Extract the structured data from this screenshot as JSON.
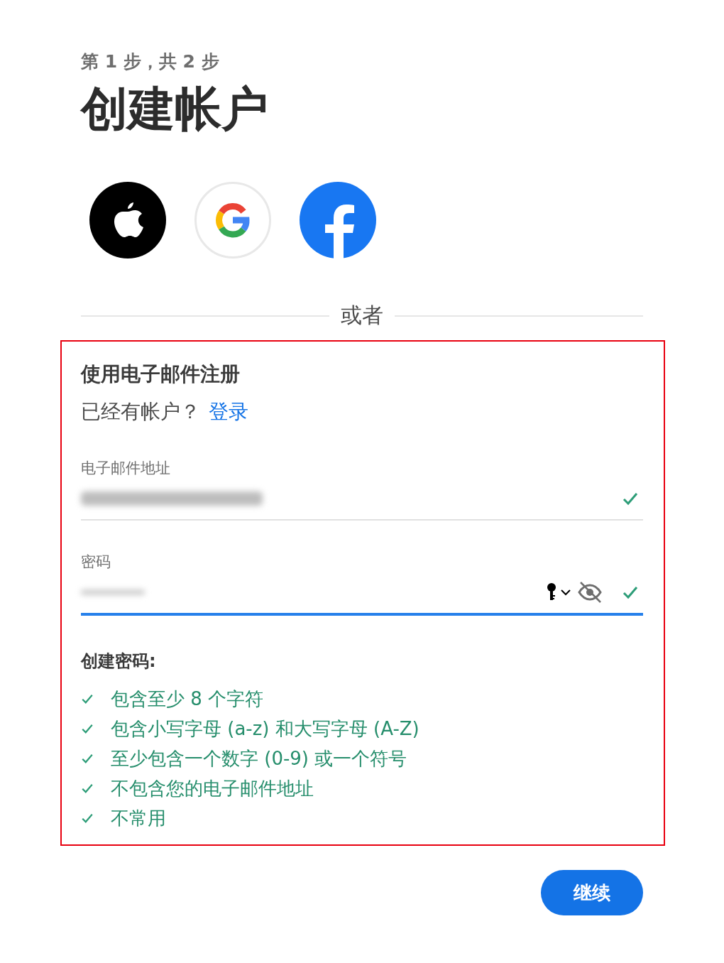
{
  "step": "第 1 步，共 2 步",
  "title": "创建帐户",
  "social_buttons": [
    {
      "kind": "apple"
    },
    {
      "kind": "google"
    },
    {
      "kind": "facebook"
    }
  ],
  "divider": "或者",
  "signup": {
    "heading": "使用电子邮件注册",
    "account_prompt": "已经有帐户？",
    "sign_in_link": "登录",
    "fields": [
      {
        "label": "电子邮件地址",
        "kind": "email",
        "valid": true,
        "focused": false
      },
      {
        "label": "密码",
        "kind": "password",
        "valid": true,
        "focused": true
      }
    ],
    "rules_title": "创建密码:",
    "rules": [
      {
        "text": "包含至少 8 个字符",
        "met": true
      },
      {
        "text": "包含小写字母 (a-z) 和大写字母 (A-Z)",
        "met": true
      },
      {
        "text": "至少包含一个数字 (0-9) 或一个符号",
        "met": true
      },
      {
        "text": "不包含您的电子邮件地址",
        "met": true
      },
      {
        "text": "不常用",
        "met": true
      }
    ]
  },
  "continue_button": "继续"
}
